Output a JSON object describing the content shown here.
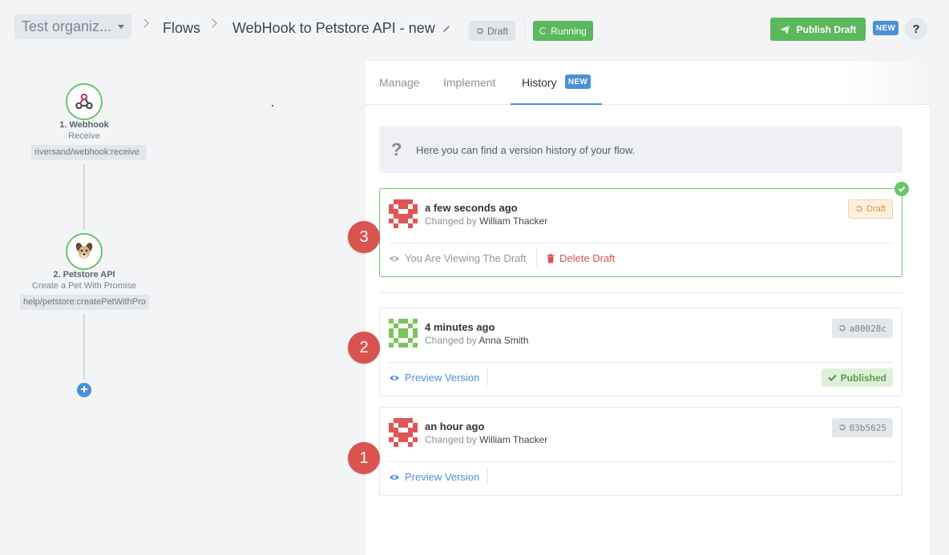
{
  "header": {
    "org_select": "Test organiz...",
    "breadcrumb_flows": "Flows",
    "flow_title": "WebHook to Petstore API - new",
    "draft_label": "Draft",
    "running_label": "Running",
    "publish_label": "Publish Draft",
    "new_badge": "NEW",
    "help": "?"
  },
  "flow": {
    "nodes": [
      {
        "title": "1. Webhook",
        "subtitle": "Receive",
        "tag": "riversand/webhook:receive",
        "icon": "webhook-icon"
      },
      {
        "title": "2. Petstore API",
        "subtitle": "Create a Pet With Promise",
        "tag": "help/petstore:createPetWithPro",
        "icon": "dog-icon"
      }
    ],
    "add": "+"
  },
  "panel": {
    "tabs": [
      {
        "label": "Manage"
      },
      {
        "label": "Implement"
      },
      {
        "label": "History",
        "badge": "NEW"
      }
    ],
    "info_text": "Here you can find a version history of your flow.",
    "versions": [
      {
        "time": "a few seconds ago",
        "changed_by_prefix": "Changed by",
        "author": "William Thacker",
        "chip": "Draft",
        "action1": "You Are Viewing The Draft",
        "action2": "Delete Draft",
        "marker": "3"
      },
      {
        "time": "4 minutes ago",
        "changed_by_prefix": "Changed by",
        "author": "Anna Smith",
        "chip": "a80028c",
        "action1": "Preview Version",
        "status": "Published",
        "marker": "2"
      },
      {
        "time": "an hour ago",
        "changed_by_prefix": "Changed by",
        "author": "William Thacker",
        "chip": "03b5625",
        "action1": "Preview Version",
        "marker": "1"
      }
    ]
  },
  "colors": {
    "green": "#5cb85c",
    "blue": "#4a90d9",
    "red": "#d9534f",
    "orange": "#e8922f"
  }
}
